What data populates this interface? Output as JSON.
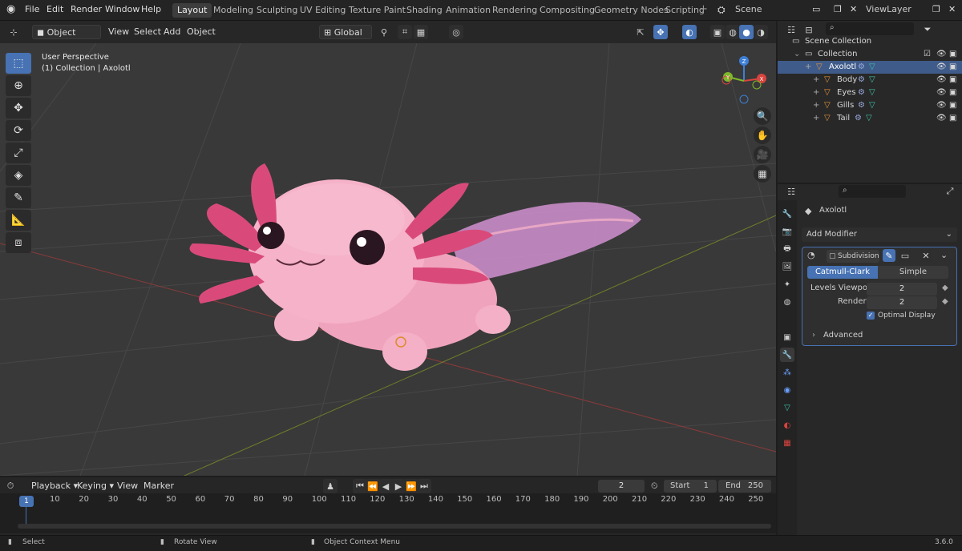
{
  "topbar": {
    "menus": [
      "File",
      "Edit",
      "Render",
      "Window",
      "Help"
    ],
    "workspaces": [
      "Layout",
      "Modeling",
      "Sculpting",
      "UV Editing",
      "Texture Paint",
      "Shading",
      "Animation",
      "Rendering",
      "Compositing",
      "Geometry Nodes",
      "Scripting"
    ],
    "active_workspace": "Layout",
    "scene_name": "Scene",
    "view_layer": "ViewLayer"
  },
  "viewport_header": {
    "mode": "Object Mode",
    "menus": [
      "View",
      "Select",
      "Add",
      "Object"
    ],
    "orientation": "Global"
  },
  "viewport": {
    "perspective": "User Perspective",
    "collection_info": "(1) Collection | Axolotl",
    "gizmo_axes": {
      "z": "Z",
      "x": "X",
      "y": "Y"
    }
  },
  "outliner": {
    "scene_collection": "Scene Collection",
    "collection": "Collection",
    "objects": [
      {
        "name": "Axolotl",
        "selected": true
      },
      {
        "name": "Body"
      },
      {
        "name": "Eyes"
      },
      {
        "name": "Gills"
      },
      {
        "name": "Tail"
      }
    ]
  },
  "properties": {
    "object_name": "Axolotl",
    "add_modifier": "Add Modifier",
    "modifier": {
      "name": "Subdivision",
      "tabs": [
        "Catmull-Clark",
        "Simple"
      ],
      "active_tab": "Catmull-Clark",
      "levels_viewport_label": "Levels Viewport",
      "levels_viewport": "2",
      "render_label": "Render",
      "render": "2",
      "optimal_display": "Optimal Display",
      "advanced": "Advanced"
    }
  },
  "timeline": {
    "menus": [
      "Playback",
      "Keying",
      "View",
      "Marker"
    ],
    "current_frame": "2",
    "start_label": "Start",
    "start": "1",
    "end_label": "End",
    "end": "250",
    "frames": [
      "10",
      "20",
      "30",
      "40",
      "50",
      "60",
      "70",
      "80",
      "90",
      "100",
      "110",
      "120",
      "130",
      "140",
      "150",
      "160",
      "170",
      "180",
      "190",
      "200",
      "210",
      "220",
      "230",
      "240",
      "250"
    ],
    "playhead": "1"
  },
  "statusbar": {
    "select": "Select",
    "rotate": "Rotate View",
    "context": "Object Context Menu",
    "version": "3.6.0"
  },
  "colors": {
    "accent": "#4772b3",
    "axis_x": "#d9443f",
    "axis_y": "#7fb82a",
    "axis_z": "#3d7fd6",
    "axolotl_body": "#f2a6c0",
    "gills": "#d94a7a"
  }
}
